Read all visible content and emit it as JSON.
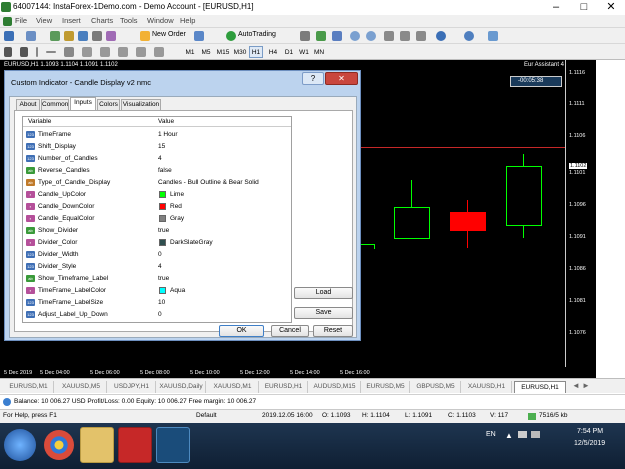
{
  "window": {
    "title": "64007144: InstaForex-1Demo.com - Demo Account - [EURUSD,H1]",
    "minimize": "–",
    "maximize": "□",
    "close": "✕"
  },
  "menu": [
    "File",
    "View",
    "Insert",
    "Charts",
    "Tools",
    "Window",
    "Help"
  ],
  "toolbar": {
    "new_order": "New Order",
    "autotrading": "AutoTrading",
    "timeframes": [
      "M1",
      "M5",
      "M15",
      "M30",
      "H1",
      "H4",
      "D1",
      "W1",
      "MN"
    ],
    "active_timeframe": "H1"
  },
  "chart": {
    "header": "EURUSD,H1  1.1093 1.1104 1.1091 1.1102",
    "ea_label": "Eur Assistant 4",
    "countdown": "-00:05:38",
    "price_ticks": [
      "1.1116",
      "1.1111",
      "1.1106",
      "1.1102",
      "1.1101",
      "1.1096",
      "1.1091",
      "1.1086",
      "1.1081",
      "1.1076"
    ],
    "time_ticks": [
      "5 Dec 2019",
      "5 Dec 04:00",
      "5 Dec 06:00",
      "5 Dec 08:00",
      "5 Dec 10:00",
      "5 Dec 12:00",
      "5 Dec 14:00",
      "5 Dec 16:00"
    ]
  },
  "dialog": {
    "title": "Custom Indicator - Candle Display v2 nmc",
    "help": "?",
    "close": "✕",
    "tabs": [
      "About",
      "Common",
      "Inputs",
      "Colors",
      "Visualization"
    ],
    "active_tab": "Inputs",
    "headers": {
      "variable": "Variable",
      "value": "Value"
    },
    "params": [
      {
        "icon": "123",
        "name": "TimeFrame",
        "value": "1 Hour"
      },
      {
        "icon": "123",
        "name": "Shift_Display",
        "value": "15"
      },
      {
        "icon": "123",
        "name": "Number_of_Candles",
        "value": "4"
      },
      {
        "icon": "bool",
        "name": "Reverse_Candles",
        "value": "false"
      },
      {
        "icon": "enum",
        "name": "Type_of_Candle_Display",
        "value": "Candles - Bull Outline & Bear Solid"
      },
      {
        "icon": "color",
        "name": "Candle_UpColor",
        "value": "Lime",
        "swatch": "#00ff00"
      },
      {
        "icon": "color",
        "name": "Candle_DownColor",
        "value": "Red",
        "swatch": "#ff0000"
      },
      {
        "icon": "color",
        "name": "Candle_EqualColor",
        "value": "Gray",
        "swatch": "#808080"
      },
      {
        "icon": "bool",
        "name": "Show_Divider",
        "value": "true"
      },
      {
        "icon": "color",
        "name": "Divider_Color",
        "value": "DarkSlateGray",
        "swatch": "#2f4f4f"
      },
      {
        "icon": "123",
        "name": "Divider_Width",
        "value": "0"
      },
      {
        "icon": "123",
        "name": "Divider_Style",
        "value": "4"
      },
      {
        "icon": "bool",
        "name": "Show_Timeframe_Label",
        "value": "true"
      },
      {
        "icon": "color",
        "name": "TimeFrame_LabelColor",
        "value": "Aqua",
        "swatch": "#00ffff"
      },
      {
        "icon": "123",
        "name": "TimeFrame_LabelSize",
        "value": "10"
      },
      {
        "icon": "123",
        "name": "Adjust_Label_Up_Down",
        "value": "0"
      }
    ],
    "load": "Load",
    "save": "Save",
    "ok": "OK",
    "cancel": "Cancel",
    "reset": "Reset"
  },
  "symbol_tabs": [
    "EURUSD,M1",
    "XAUUSD,M5",
    "USDJPY,H1",
    "XAUUSD,Daily",
    "XAUUSD,M1",
    "EURUSD,H1",
    "AUDUSD,M15",
    "EURUSD,M5",
    "GBPUSD,M5",
    "XAUUSD,H1",
    "EURUSD,H1"
  ],
  "active_symbol_tab": 10,
  "account": "Balance: 10 006.27 USD  Profit/Loss: 0.00  Equity: 10 006.27  Free margin: 10 006.27",
  "status": {
    "help": "For Help, press F1",
    "profile": "Default",
    "time": "2019.12.05 16:00",
    "open": "O: 1.1093",
    "high": "H: 1.1104",
    "low": "L: 1.1091",
    "close": "C: 1.1103",
    "volume": "V: 117",
    "traffic": "7516/5 kb"
  },
  "taskbar": {
    "lang": "EN",
    "clock_time": "7:54 PM",
    "clock_date": "12/5/2019"
  },
  "colors": {
    "bull": "#00ff00",
    "bear": "#ff0000",
    "chart_bg": "#000000"
  }
}
